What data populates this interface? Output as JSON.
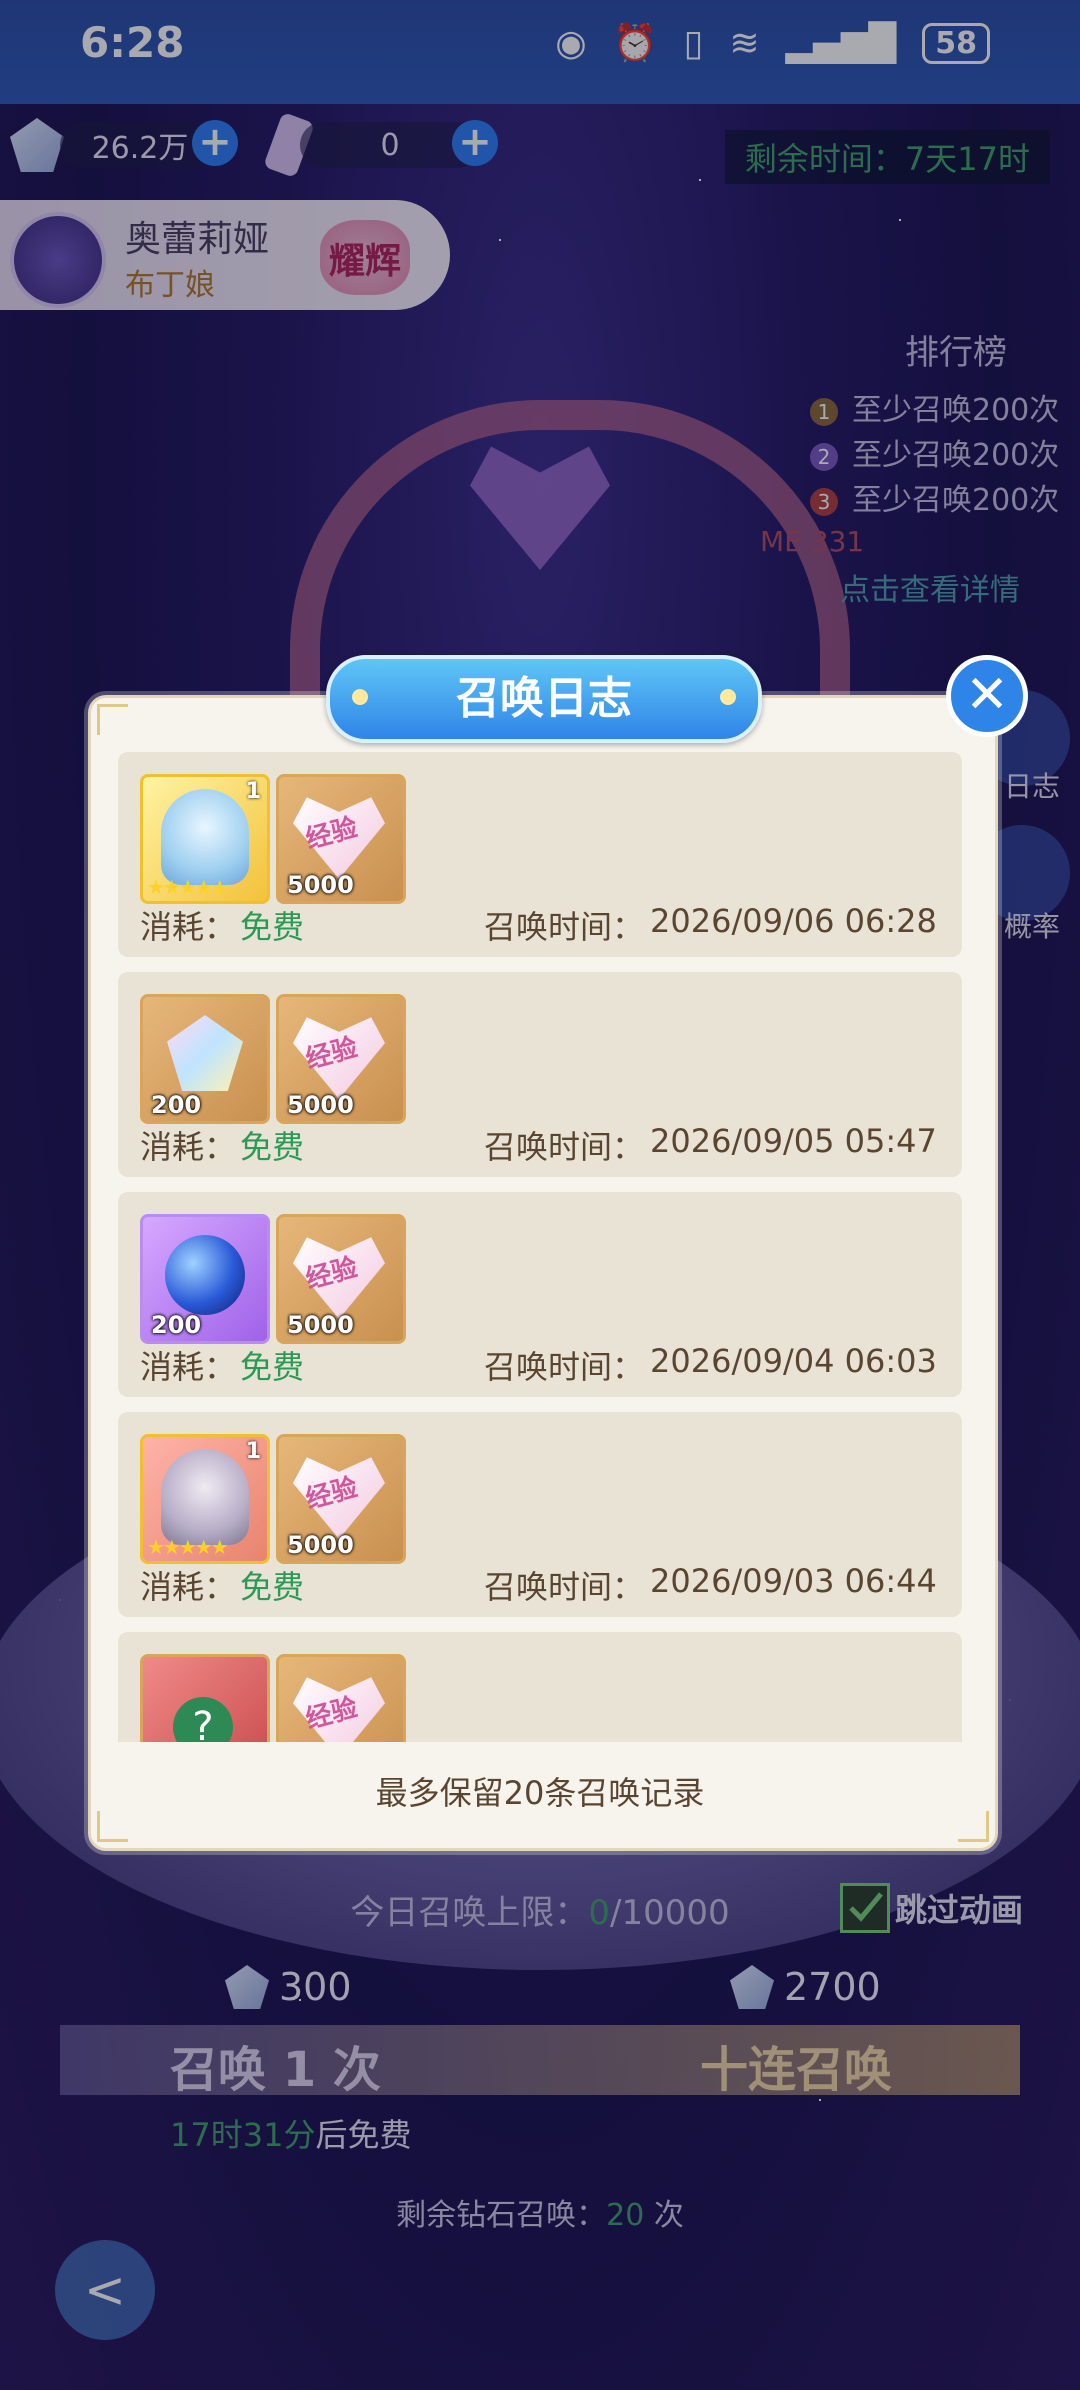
{
  "status_bar": {
    "time": "6:28",
    "battery": "58"
  },
  "resources": {
    "diamonds": "26.2万",
    "tickets": "0",
    "remaining_time": "剩余时间：7天17时"
  },
  "character": {
    "name": "奥蕾莉娅",
    "subtitle": "布丁娘",
    "badge": "耀辉"
  },
  "ranking": {
    "title": "排行榜",
    "items": [
      "至少召唤200次",
      "至少召唤200次",
      "至少召唤200次"
    ],
    "me": "ME 331",
    "detail_link": "点击查看详情"
  },
  "side_buttons": [
    "日志",
    "概率"
  ],
  "dialog": {
    "title": "召唤日志",
    "entries": [
      {
        "items": [
          {
            "type": "hero",
            "level": "1"
          },
          {
            "type": "exp",
            "qty": "5000",
            "label": "经验"
          }
        ],
        "cost_label": "消耗：",
        "cost_value": "免费",
        "time_label": "召唤时间：",
        "time_value": "2026/09/06 06:28"
      },
      {
        "items": [
          {
            "type": "crystal",
            "qty": "200"
          },
          {
            "type": "exp",
            "qty": "5000",
            "label": "经验"
          }
        ],
        "cost_label": "消耗：",
        "cost_value": "免费",
        "time_label": "召唤时间：",
        "time_value": "2026/09/05 05:47"
      },
      {
        "items": [
          {
            "type": "orb",
            "qty": "200"
          },
          {
            "type": "exp",
            "qty": "5000",
            "label": "经验"
          }
        ],
        "cost_label": "消耗：",
        "cost_value": "免费",
        "time_label": "召唤时间：",
        "time_value": "2026/09/04 06:03"
      },
      {
        "items": [
          {
            "type": "hero",
            "level": "1"
          },
          {
            "type": "exp",
            "qty": "5000",
            "label": "经验"
          }
        ],
        "cost_label": "消耗：",
        "cost_value": "免费",
        "time_label": "召唤时间：",
        "time_value": "2026/09/03 06:44"
      },
      {
        "items": [
          {
            "type": "book"
          },
          {
            "type": "exp",
            "label": "经验"
          }
        ]
      }
    ],
    "footer": "最多保留20条召唤记录"
  },
  "summon": {
    "daily_limit_label": "今日召唤上限：",
    "daily_limit_value": "0",
    "daily_limit_max": "/10000",
    "skip_animation": "跳过动画",
    "cost_one": "300",
    "cost_ten": "2700",
    "one_label": "召唤 1 次",
    "ten_label": "十连召唤",
    "free_time": "17时31分",
    "free_suffix": "后免费",
    "remaining_diamond_label": "剩余钻石召唤：",
    "remaining_diamond_value": "20",
    "remaining_diamond_unit": " 次"
  },
  "colors": {
    "dialog_bg": "#f7f4ee",
    "title_blue": "#2f84e8",
    "free_green": "#2b9a55"
  }
}
